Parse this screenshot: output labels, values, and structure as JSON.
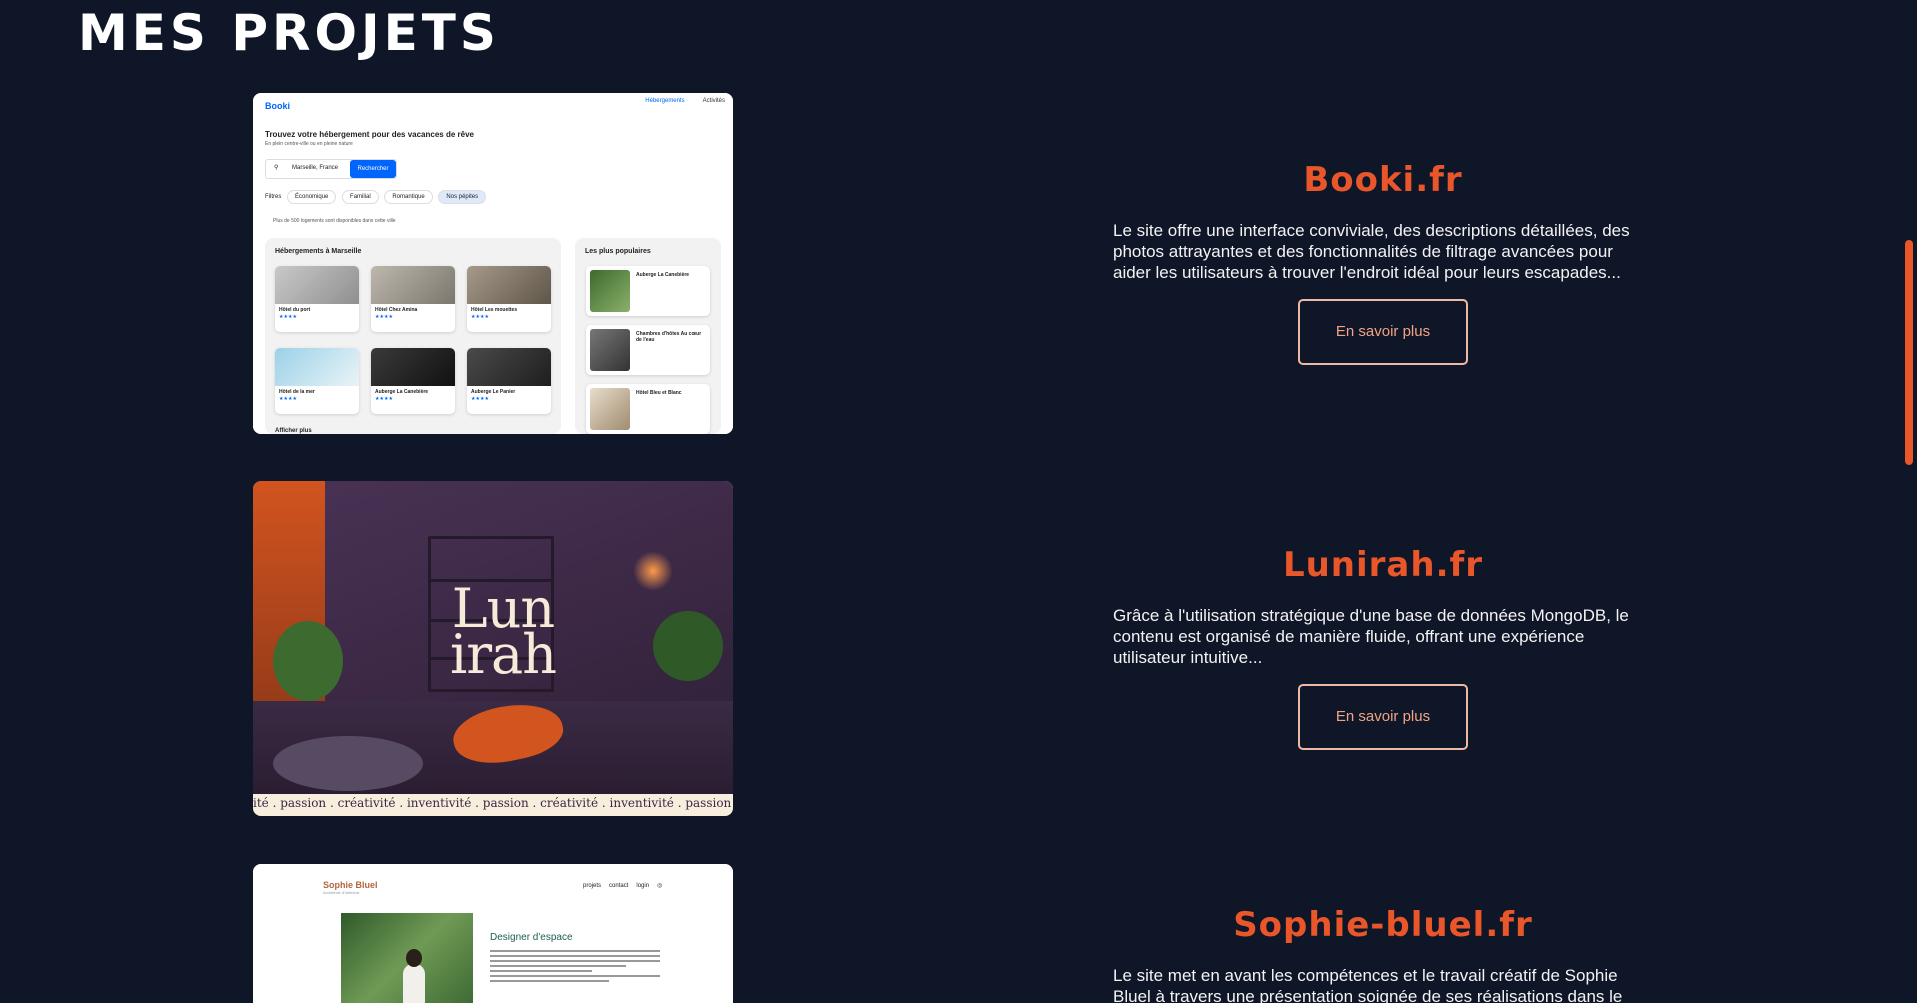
{
  "section_title": "MES PROJETS",
  "projects": [
    {
      "title": "Booki.fr",
      "description": "Le site offre une interface conviviale, des descriptions détaillées, des photos attrayantes et des fonctionnalités de filtrage avancées pour aider les utilisateurs à trouver l'endroit idéal pour leurs escapades...",
      "button": "En savoir plus"
    },
    {
      "title": "Lunirah.fr",
      "description": "Grâce à l'utilisation stratégique d'une base de données MongoDB, le contenu est organisé de manière fluide, offrant une expérience utilisateur intuitive...",
      "button": "En savoir plus"
    },
    {
      "title": "Sophie-bluel.fr",
      "description": "Le site met en avant les compétences et le travail créatif de Sophie Bluel à travers une présentation soignée de ses réalisations dans le"
    }
  ],
  "booki_preview": {
    "logo": "Booki",
    "nav": [
      "Hébergements",
      "Activités"
    ],
    "headline": "Trouvez votre hébergement pour des vacances de rêve",
    "subline": "En plein centre-ville ou en pleine nature",
    "location": "Marseille, France",
    "search_button": "Rechercher",
    "filters_label": "Filtres",
    "filters": [
      "Économique",
      "Familial",
      "Romantique",
      "Nos pépites"
    ],
    "note": "Plus de 500 logements sont disponibles dans cette ville",
    "panel_title": "Hébergements à Marseille",
    "hotels": [
      "Hôtel du port",
      "Hôtel Chez Amina",
      "Hôtel Les mouettes",
      "Hôtel de la mer",
      "Auberge La Canebière",
      "Auberge Le Panier"
    ],
    "popular_title": "Les plus populaires",
    "popular": [
      "Auberge La Canebière",
      "Chambres d'hôtes Au cœur de l'eau",
      "Hôtel Bleu et Blanc"
    ],
    "more": "Afficher plus",
    "stars": "★★★★"
  },
  "lunirah_preview": {
    "logo_line1": "Lun",
    "logo_line2": "irah",
    "band": "ité . passion . créativité . inventivité . passion . créativité . inventivité . passion . créa"
  },
  "sophie_preview": {
    "logo": "Sophie Bluel",
    "logo_sub": "Architecte d'intérieur",
    "nav": [
      "projets",
      "contact",
      "login"
    ],
    "heading": "Designer d'espace"
  },
  "colors": {
    "background": "#0f1628",
    "accent": "#e8562a",
    "button_border": "#f0b9a6"
  }
}
